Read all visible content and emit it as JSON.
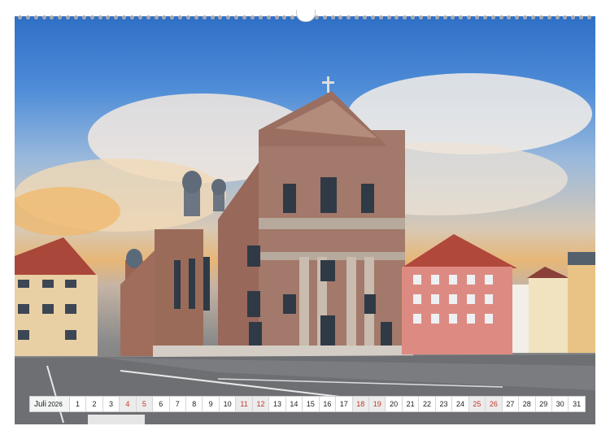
{
  "calendar": {
    "month": "Juli",
    "year": "2026",
    "days": [
      "1",
      "2",
      "3",
      "4",
      "5",
      "6",
      "7",
      "8",
      "9",
      "10",
      "11",
      "12",
      "13",
      "14",
      "15",
      "16",
      "17",
      "18",
      "19",
      "20",
      "21",
      "22",
      "23",
      "24",
      "25",
      "26",
      "27",
      "28",
      "29",
      "30",
      "31"
    ],
    "weekend_days": [
      "4",
      "5",
      "11",
      "12",
      "18",
      "19",
      "25",
      "26"
    ]
  },
  "colors": {
    "weekend_text": "#c0392b",
    "sky_top": "#2f6fc6",
    "facade": "#a2796a"
  },
  "photo": {
    "subject": "church-facade-photo"
  }
}
